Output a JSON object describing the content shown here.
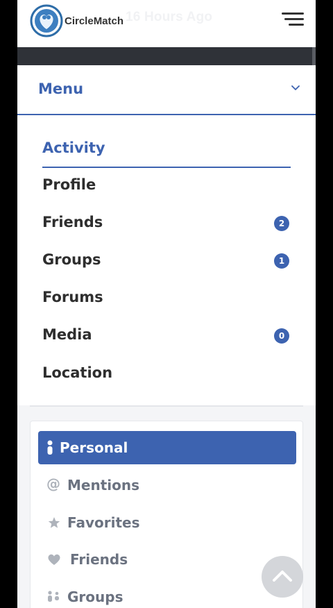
{
  "header": {
    "brand": "CircleMatch",
    "ghost_text": "16 Hours Ago"
  },
  "menu": {
    "title": "Menu"
  },
  "nav": {
    "items": [
      {
        "label": "Activity"
      },
      {
        "label": "Profile"
      },
      {
        "label": "Friends",
        "badge": "2"
      },
      {
        "label": "Groups",
        "badge": "1"
      },
      {
        "label": "Forums"
      },
      {
        "label": "Media",
        "badge": "0"
      },
      {
        "label": "Location"
      }
    ]
  },
  "filters": {
    "items": [
      {
        "label": "Personal",
        "icon": "personal-icon"
      },
      {
        "label": "Mentions",
        "icon": "at-icon"
      },
      {
        "label": "Favorites",
        "icon": "star-icon"
      },
      {
        "label": "Friends",
        "icon": "heart-icon"
      },
      {
        "label": "Groups",
        "icon": "groups-icon"
      }
    ]
  },
  "colors": {
    "accent": "#3d63b0",
    "text": "#2e2e2e",
    "muted": "#6b7280",
    "dark_bar": "#2f3238"
  }
}
